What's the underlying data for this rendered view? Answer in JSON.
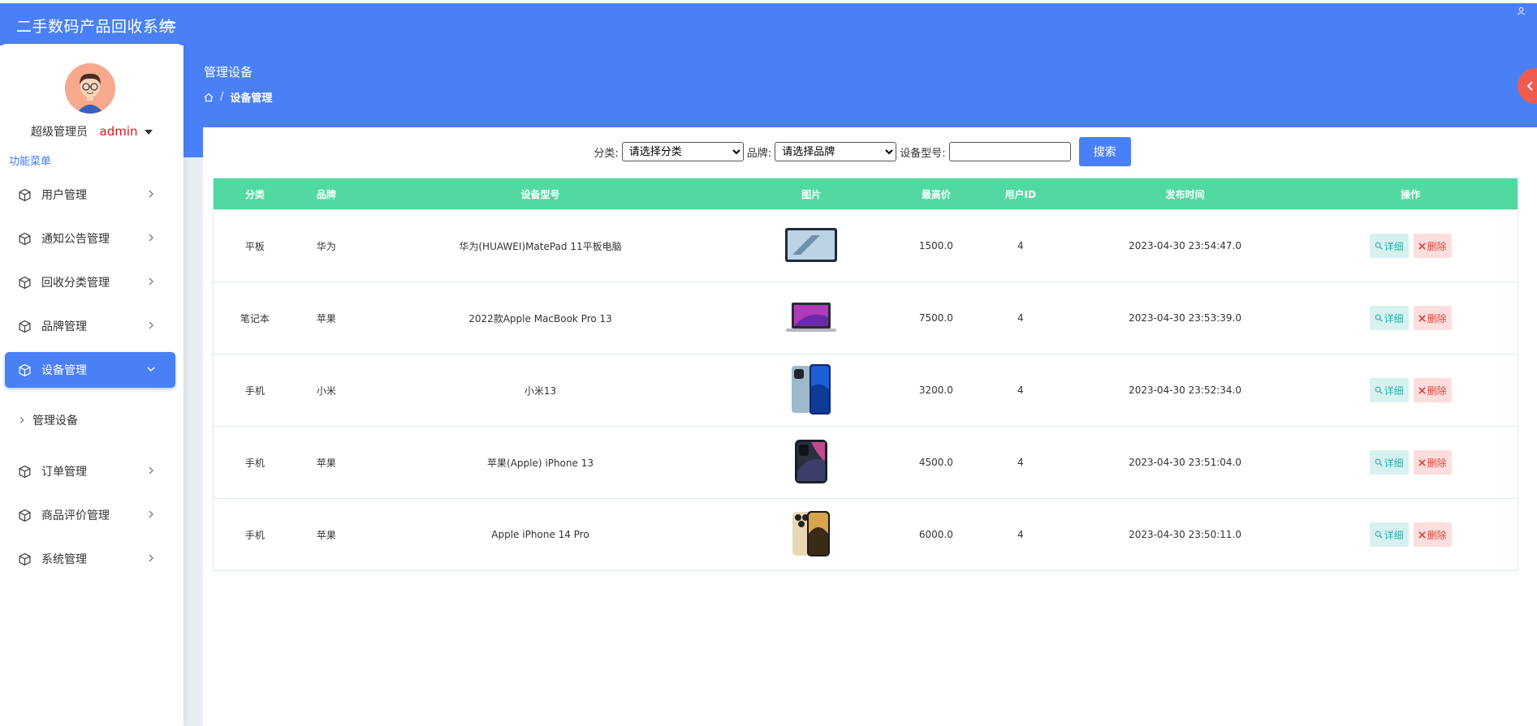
{
  "app": {
    "title": "二手数码产品回收系统"
  },
  "user": {
    "role": "超级管理员",
    "name": "admin"
  },
  "sidebar": {
    "heading": "功能菜单",
    "items": [
      {
        "label": "用户管理"
      },
      {
        "label": "通知公告管理"
      },
      {
        "label": "回收分类管理"
      },
      {
        "label": "品牌管理"
      },
      {
        "label": "设备管理"
      },
      {
        "label": "订单管理"
      },
      {
        "label": "商品评价管理"
      },
      {
        "label": "系统管理"
      }
    ],
    "active_sub": "管理设备"
  },
  "page": {
    "title": "管理设备",
    "breadcrumb": "设备管理"
  },
  "search": {
    "category_label": "分类:",
    "category_value": "请选择分类",
    "brand_label": "品牌:",
    "brand_value": "请选择品牌",
    "model_label": "设备型号:",
    "model_value": "",
    "button": "搜索"
  },
  "table": {
    "columns": [
      "分类",
      "品牌",
      "设备型号",
      "图片",
      "最高价",
      "用户ID",
      "发布时间",
      "操作"
    ],
    "detail_label": "详细",
    "delete_label": "删除",
    "rows": [
      {
        "category": "平板",
        "brand": "华为",
        "model": "华为(HUAWEI)MatePad 11平板电脑",
        "image": "tablet",
        "price": "1500.0",
        "user_id": "4",
        "time": "2023-04-30 23:54:47.0"
      },
      {
        "category": "笔记本",
        "brand": "苹果",
        "model": "2022款Apple MacBook Pro 13",
        "image": "laptop",
        "price": "7500.0",
        "user_id": "4",
        "time": "2023-04-30 23:53:39.0"
      },
      {
        "category": "手机",
        "brand": "小米",
        "model": "小米13",
        "image": "phone-blue",
        "price": "3200.0",
        "user_id": "4",
        "time": "2023-04-30 23:52:34.0"
      },
      {
        "category": "手机",
        "brand": "苹果",
        "model": "苹果(Apple) iPhone 13",
        "image": "phone-dark",
        "price": "4500.0",
        "user_id": "4",
        "time": "2023-04-30 23:51:04.0"
      },
      {
        "category": "手机",
        "brand": "苹果",
        "model": "Apple iPhone 14 Pro",
        "image": "phone-gold",
        "price": "6000.0",
        "user_id": "4",
        "time": "2023-04-30 23:50:11.0"
      }
    ]
  },
  "colors": {
    "primary": "#4a80f5",
    "table_header": "#51d9a1",
    "accent_red": "#d9141f"
  }
}
